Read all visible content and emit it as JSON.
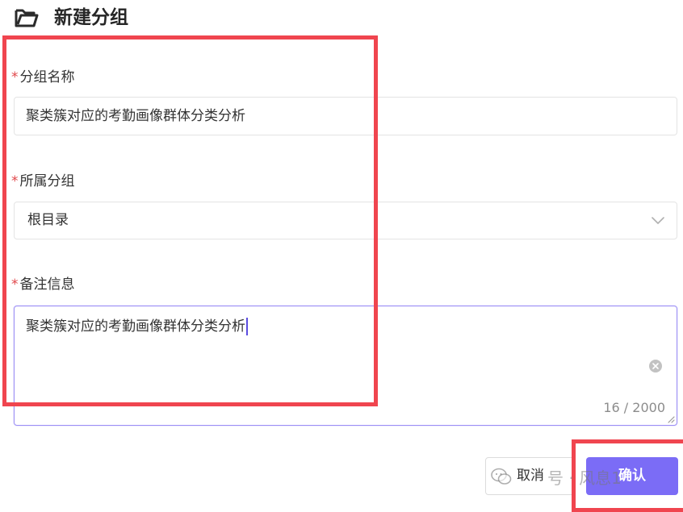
{
  "dialog": {
    "title": "新建分组",
    "icon": "folder-open-icon"
  },
  "form": {
    "required_mark": "*",
    "group_name": {
      "label": "分组名称",
      "value": "聚类簇对应的考勤画像群体分类分析"
    },
    "parent_group": {
      "label": "所属分组",
      "selected": "根目录"
    },
    "remark": {
      "label": "备注信息",
      "value": "聚类簇对应的考勤画像群体分类分析",
      "char_count": "16 / 2000"
    }
  },
  "footer": {
    "cancel_label": "取消",
    "confirm_label": "确认"
  },
  "watermark": {
    "text": "号 · 风息1"
  },
  "colors": {
    "required": "#e0474a",
    "accent": "#7b6cf6",
    "focus_border": "#9b8ef5",
    "highlight": "#f0454f"
  }
}
